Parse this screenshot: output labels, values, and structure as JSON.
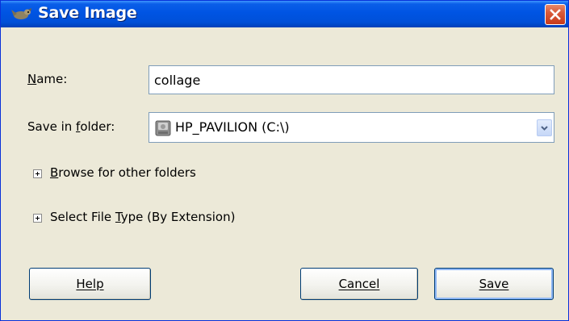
{
  "window": {
    "title": "Save Image",
    "close_icon": "close-icon",
    "app_icon": "gimp-wilber-icon"
  },
  "form": {
    "name_label_first": "N",
    "name_label_rest": "ame:",
    "name_value": "collage",
    "folder_label_prefix": "Save in ",
    "folder_label_mnemonic": "f",
    "folder_label_rest": "older:",
    "folder_value": "HP_PAVILION (C:\\)",
    "folder_icon": "hard-drive-icon"
  },
  "expanders": {
    "browse_mnemonic": "B",
    "browse_rest": "rowse for other folders",
    "filetype_prefix": "Select File ",
    "filetype_mnemonic": "T",
    "filetype_rest": "ype (By Extension)"
  },
  "buttons": {
    "help": "Help",
    "cancel": "Cancel",
    "save": "Save"
  },
  "colors": {
    "titlebar": "#0054e3",
    "dialog_bg": "#ece9d8",
    "close_button": "#d85a3a",
    "input_border": "#7f9db9"
  }
}
